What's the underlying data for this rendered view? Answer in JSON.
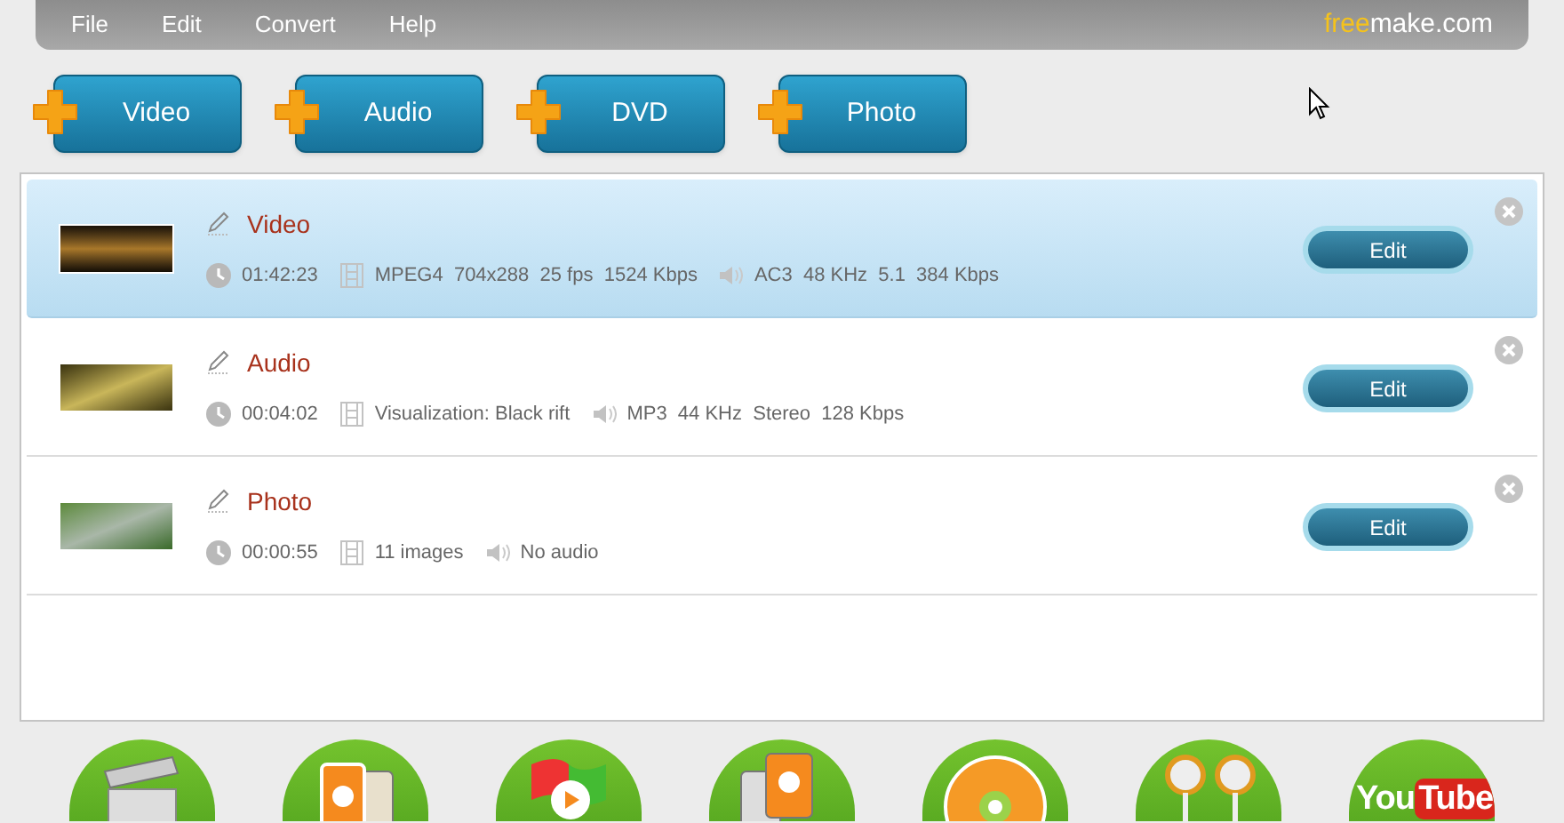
{
  "menu": [
    "File",
    "Edit",
    "Convert",
    "Help"
  ],
  "logo": {
    "part_1": "free",
    "part_2": "make.com"
  },
  "add_buttons": [
    "Video",
    "Audio",
    "DVD",
    "Photo"
  ],
  "files": [
    {
      "title": "Video",
      "selected": true,
      "kind": "video",
      "duration": "01:42:23",
      "video": "MPEG4  704x288  25 fps  1524 Kbps",
      "audio": "AC3  48 KHz  5.1  384 Kbps",
      "edit": "Edit"
    },
    {
      "title": "Audio",
      "selected": false,
      "kind": "audio",
      "duration": "00:04:02",
      "video": "Visualization: Black rift",
      "audio": "MP3  44 KHz  Stereo  128 Kbps",
      "edit": "Edit"
    },
    {
      "title": "Photo",
      "selected": false,
      "kind": "photo",
      "duration": "00:00:55",
      "video": "11 images",
      "audio": "No audio",
      "edit": "Edit"
    }
  ],
  "outputs": [
    {
      "kind": "clapper"
    },
    {
      "kind": "cards"
    },
    {
      "kind": "windows"
    },
    {
      "kind": "phone"
    },
    {
      "kind": "disc"
    },
    {
      "kind": "earphones"
    },
    {
      "kind": "youtube",
      "label_1": "You",
      "label_2": "Tube"
    }
  ]
}
